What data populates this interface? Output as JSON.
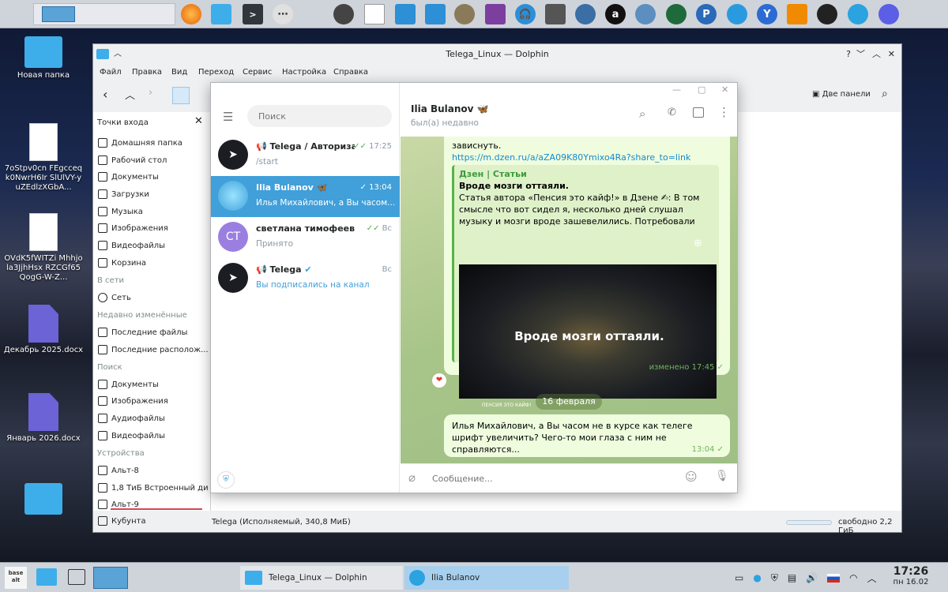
{
  "dolphin": {
    "title": "Telega_Linux — Dolphin",
    "menu": [
      "Файл",
      "Правка",
      "Вид",
      "Переход",
      "Сервис",
      "Настройка",
      "Справка"
    ],
    "split_label": "Две панели",
    "sidebar": {
      "title": "Точки входа",
      "places": [
        "Домашняя папка",
        "Рабочий стол",
        "Документы",
        "Загрузки",
        "Музыка",
        "Изображения",
        "Видеофайлы",
        "Корзина"
      ],
      "network_header": "В сети",
      "network": [
        "Сеть"
      ],
      "recent_header": "Недавно изменённые",
      "recent": [
        "Последние файлы",
        "Последние располож..."
      ],
      "search_header": "Поиск",
      "search": [
        "Документы",
        "Изображения",
        "Аудиофайлы",
        "Видеофайлы"
      ],
      "devices_header": "Устройства",
      "devices": [
        "Альт-8",
        "1,8 ТиБ Встроенный ди...",
        "Альт-9",
        "Кубунта"
      ]
    },
    "status": "Telega (Исполняемый, 340,8 МиБ)",
    "free_space": "свободно 2,2 ГиБ"
  },
  "desktop": {
    "icons": [
      {
        "label": "Новая папка"
      },
      {
        "label": "7oStpv0cn FEgcceqk0NwrH6Ir SlUlVY-yuZEdlzXGbA..."
      },
      {
        "label": "OVdK5fWITZi Mhhjola3JjhHsx RZCGf65QogG-W-Z..."
      },
      {
        "label": "Декабрь 2025.docx"
      },
      {
        "label": "Январь 2026.docx"
      }
    ]
  },
  "telegram": {
    "search_placeholder": "Поиск",
    "chats": [
      {
        "name": "📢 Telega / Авторизац...",
        "time": "17:25",
        "sub": "/start"
      },
      {
        "name": "Ilia Bulanov 🦋",
        "time": "13:04",
        "sub": "Илья Михайлович, а Вы часом..."
      },
      {
        "name": "светлана тимофеева",
        "time": "Вс",
        "sub": "Принято",
        "initials": "СТ"
      },
      {
        "name": "📢 Telega",
        "time": "Вс",
        "sub": "Вы подписались на канал"
      }
    ],
    "header": {
      "name": "Ilia Bulanov 🦋",
      "status": "был(а) недавно"
    },
    "message1": {
      "text_top": "зависнуть.",
      "link": "https://m.dzen.ru/a/aZA09K80Ymixo4Ra?share_to=link",
      "preview_source": "Дзен | Статьи",
      "preview_title": "Вроде мозги оттаяли.",
      "preview_text": "Статья автора «Пенсия это кайф!» в Дзене ✍: В том смысле что вот сидел я, несколько дней слушал музыку и мозги вроде зашевелились. Потребовали питания. С мозгами все...",
      "image_caption": "Вроде мозги оттаяли.",
      "image_small": "ПЕНСИЯ ЭТО КАЙФ!",
      "meta": "изменено 17:45",
      "reaction": "❤"
    },
    "date_divider": "16 февраля",
    "message2": {
      "text": "Илья Михайлович, а Вы часом не в курсе как телеге шрифт увеличить? Чего-то мои глаза с ним не справляются...",
      "time": "13:04"
    },
    "input_placeholder": "Сообщение..."
  },
  "taskbar": {
    "tasks": [
      {
        "label": "Telega_Linux — Dolphin"
      },
      {
        "label": "Ilia Bulanov"
      }
    ],
    "clock_time": "17:26",
    "clock_date": "пн 16.02",
    "logo_text": "base alt"
  },
  "colors": {
    "accent": "#419fd9",
    "panel": "#cfd3da",
    "bubble": "#effdde",
    "chat_bg": "#a8c589"
  }
}
